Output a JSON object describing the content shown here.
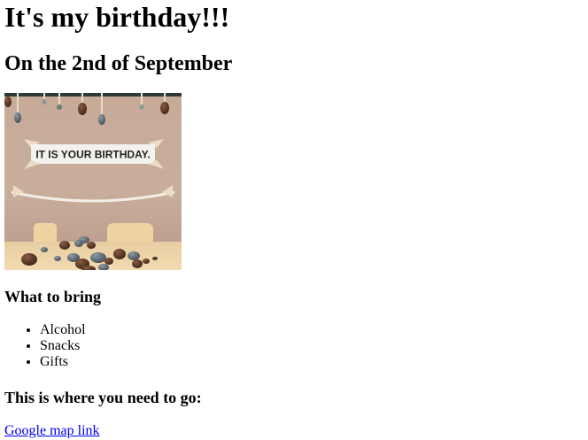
{
  "page": {
    "title": "It's my birthday!!!",
    "subtitle": "On the 2nd of September"
  },
  "image": {
    "banner_text": "IT IS YOUR BIRTHDAY."
  },
  "bring": {
    "heading": "What to bring",
    "items": [
      "Alcohol",
      "Snacks",
      "Gifts"
    ]
  },
  "directions": {
    "heading": "This is where you need to go:",
    "link_text": "Google map link"
  }
}
